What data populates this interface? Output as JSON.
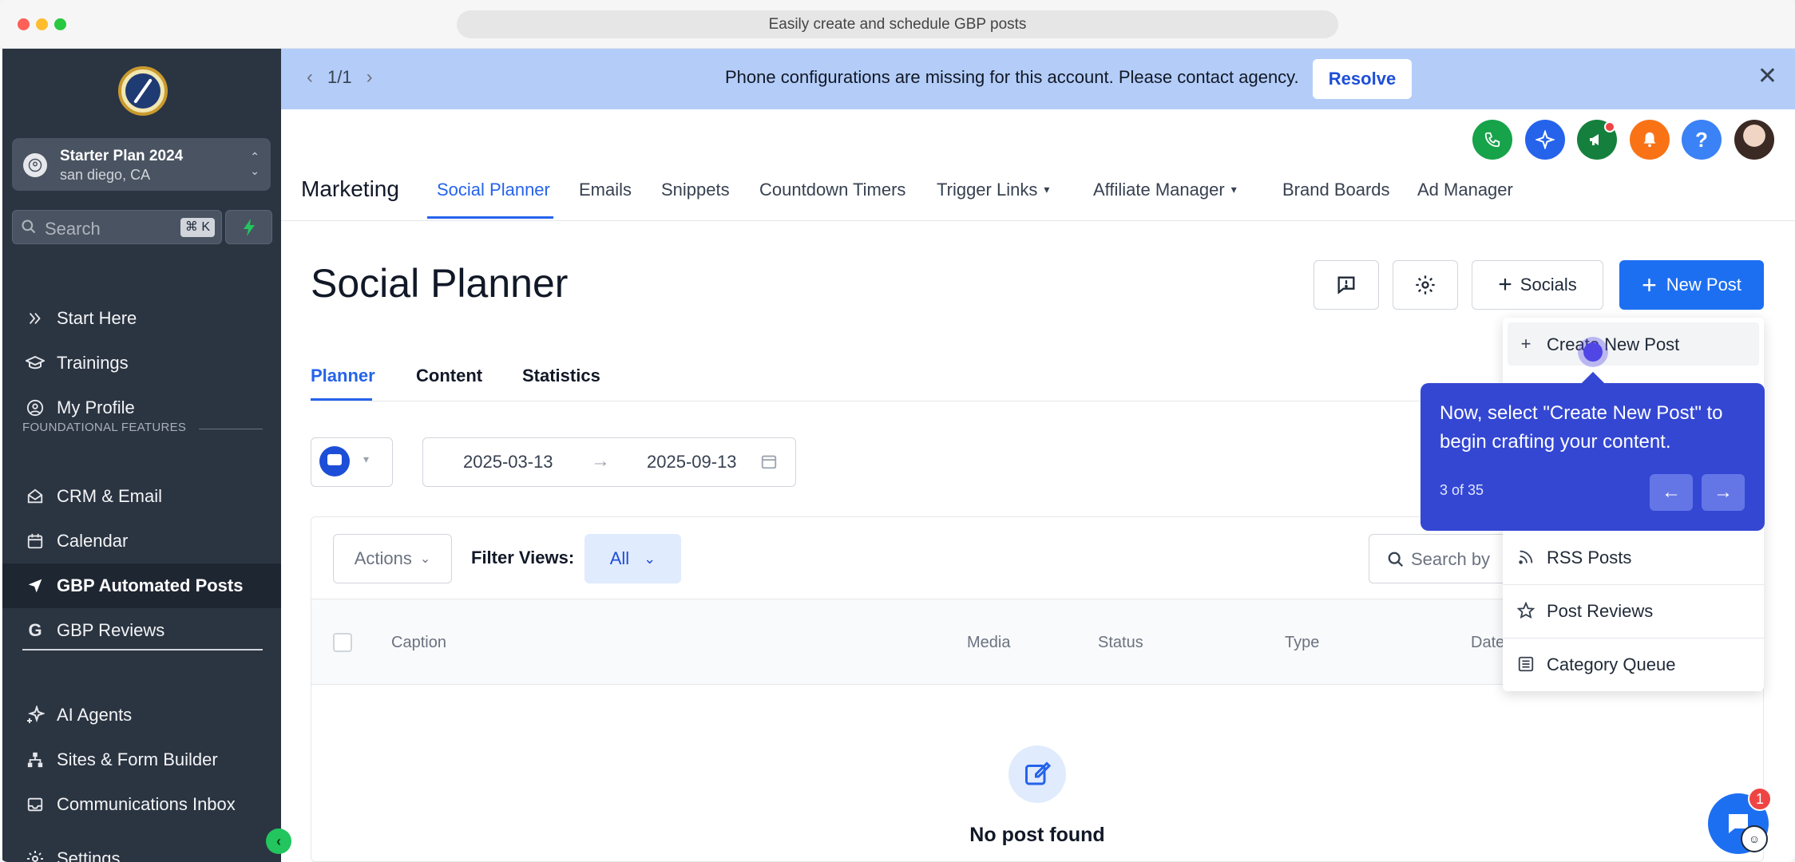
{
  "browser": {
    "url_title": "Easily create and schedule GBP posts"
  },
  "sidebar": {
    "account": {
      "name": "Starter Plan 2024",
      "location": "san diego, CA"
    },
    "search": {
      "placeholder": "Search",
      "shortcut": "⌘ K"
    },
    "items_top": [
      {
        "label": "Start Here",
        "icon": "chevrons-right-icon"
      },
      {
        "label": "Trainings",
        "icon": "graduation-cap-icon"
      },
      {
        "label": "My Profile",
        "icon": "user-circle-icon"
      }
    ],
    "section_label": "FOUNDATIONAL FEATURES",
    "items_main": [
      {
        "label": "CRM & Email",
        "icon": "envelope-open-icon"
      },
      {
        "label": "Calendar",
        "icon": "calendar-icon"
      },
      {
        "label": "GBP Automated Posts",
        "icon": "navigation-arrow-icon",
        "active": true
      },
      {
        "label": "GBP Reviews",
        "icon": "google-g-icon"
      }
    ],
    "items_bottom": [
      {
        "label": "AI Agents",
        "icon": "sparkles-icon"
      },
      {
        "label": "Sites & Form Builder",
        "icon": "sitemap-icon"
      },
      {
        "label": "Communications Inbox",
        "icon": "inbox-icon"
      }
    ],
    "settings_label": "Settings"
  },
  "banner": {
    "pager": "1/1",
    "message": "Phone configurations are missing for this account. Please contact agency.",
    "action": "Resolve"
  },
  "header_icons": [
    {
      "name": "phone-icon",
      "color": "#16a34a"
    },
    {
      "name": "sparkle-icon",
      "color": "#2563eb"
    },
    {
      "name": "megaphone-icon",
      "color": "#15803d"
    },
    {
      "name": "bell-icon",
      "color": "#f97316"
    },
    {
      "name": "help-icon",
      "color": "#3b82f6"
    }
  ],
  "topnav": {
    "brand": "Marketing",
    "items": [
      {
        "label": "Social Planner",
        "active": true
      },
      {
        "label": "Emails"
      },
      {
        "label": "Snippets"
      },
      {
        "label": "Countdown Timers"
      },
      {
        "label": "Trigger Links",
        "dropdown": true
      },
      {
        "label": "Affiliate Manager",
        "dropdown": true
      },
      {
        "label": "Brand Boards"
      },
      {
        "label": "Ad Manager"
      }
    ]
  },
  "main": {
    "title": "Social Planner",
    "socials_button": "Socials",
    "new_post_button": "New Post",
    "tabs": [
      {
        "label": "Planner",
        "active": true
      },
      {
        "label": "Content"
      },
      {
        "label": "Statistics"
      }
    ],
    "date_from": "2025-03-13",
    "date_to": "2025-09-13",
    "actions_label": "Actions",
    "filter_label": "Filter Views:",
    "filter_value": "All",
    "search_placeholder": "Search by",
    "columns": [
      "Caption",
      "Media",
      "Status",
      "Type",
      "Date"
    ],
    "empty_text": "No post found"
  },
  "dropdown": {
    "items": [
      {
        "label": "Create New Post",
        "icon": "plus-icon"
      },
      {
        "label": "RSS Posts",
        "icon": "rss-icon"
      },
      {
        "label": "Post Reviews",
        "icon": "star-icon"
      },
      {
        "label": "Category Queue",
        "icon": "list-icon"
      }
    ]
  },
  "tooltip": {
    "text": "Now, select \"Create New Post\" to begin crafting your content.",
    "step": "3 of 35"
  },
  "chat": {
    "badge": "1"
  },
  "colors": {
    "sidebar_bg": "#2b3441",
    "accent": "#2563eb",
    "banner_bg": "#b4cdf8",
    "tooltip_bg": "#3447d3"
  }
}
